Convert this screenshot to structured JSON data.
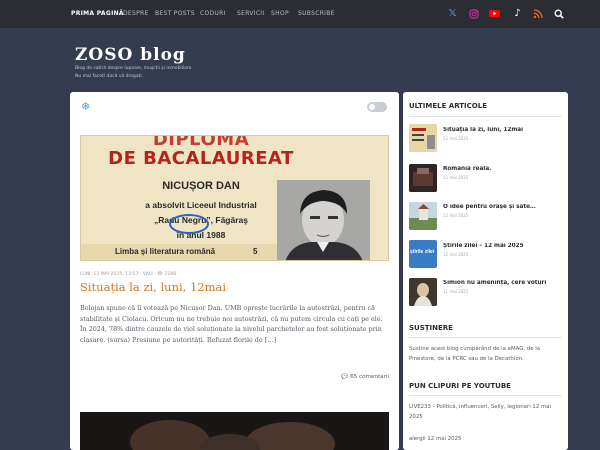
{
  "nav": {
    "items": [
      "Prima pagină",
      "Despre",
      "Best posts",
      "Coduri",
      "Servicii",
      "Shop",
      "Subscribe"
    ]
  },
  "social_icons": [
    {
      "name": "x",
      "color": "#4a90d9"
    },
    {
      "name": "instagram",
      "color": "#d6249f"
    },
    {
      "name": "youtube",
      "color": "#ff0000"
    },
    {
      "name": "tiktok",
      "color": "#ffffff"
    },
    {
      "name": "rss",
      "color": "#f26522"
    },
    {
      "name": "search",
      "color": "#ffffff"
    }
  ],
  "header": {
    "logo": "ZOSO blog",
    "tagline_1": "Blog de satiră despre lupoaie, muşchi şi inmobiliare",
    "tagline_2": "Nu mai faceți dacă vă drogați."
  },
  "post": {
    "image_text": {
      "line1": "DIPLOMA",
      "line2": "DE BACALAUREAT",
      "line3": "NICUȘOR DAN",
      "line4": "a absolvit Liceeul Industrial",
      "line5": "„Radu Negru”, Făgăraş",
      "line6": "în anul 1988",
      "line7": "Limba și literatura română",
      "grade": "5"
    },
    "meta": "Luni, 12 mai 2025, 13:57 · Vali · 👁 2288",
    "title": "Situația la zi, luni, 12mai",
    "excerpt": "Bolojan spune că îl votează pe Nicușor Dan. UMB oprește lucrările la autostrăzi, pentru că stabilitate și Ciolacu. Oricum nu ne trebuie noi autostrăzi, că nu putem circula cu cați pe ele. În 2024, 78% dintre cauzele de viol soluționate la nivelul parchetelor au fost soluționate prin clasare. (sursa) Presiune pe autorități. Refuzat florile de […]",
    "comments": "65 comentarii"
  },
  "sidebar": {
    "latest_title": "Ultimele articole",
    "articles": [
      {
        "title": "Situația la zi, luni, 12mai",
        "date": "12 mai 2025",
        "thumb_color": "#d8c79a"
      },
      {
        "title": "România reală.",
        "date": "12 mai 2025",
        "thumb_color": "#3b3030"
      },
      {
        "title": "O idee pentru orașe și sate…",
        "date": "12 mai 2025",
        "thumb_color": "#7c8f6a"
      },
      {
        "title": "Știrile zilei – 12 mai 2025",
        "date": "12 mai 2025",
        "thumb_color": "#3a7cc4"
      },
      {
        "title": "Simion nu amenință, cere voturi",
        "date": "11 mai 2025",
        "thumb_color": "#4b4237"
      }
    ],
    "thumb_word": "știrile zilei",
    "support_title": "Susținere",
    "support_text": "Susține acest blog cumpărând de la eMAG, de la Pinestore, de la PCRC sau de la Decathlon.",
    "videos_title": "Pun clipuri pe YouTube",
    "video_1": "LIVE233 - Politică, influenceri, Selly, legionari 12 mai 2025",
    "video_2": "alergii 12 mai 2025"
  }
}
